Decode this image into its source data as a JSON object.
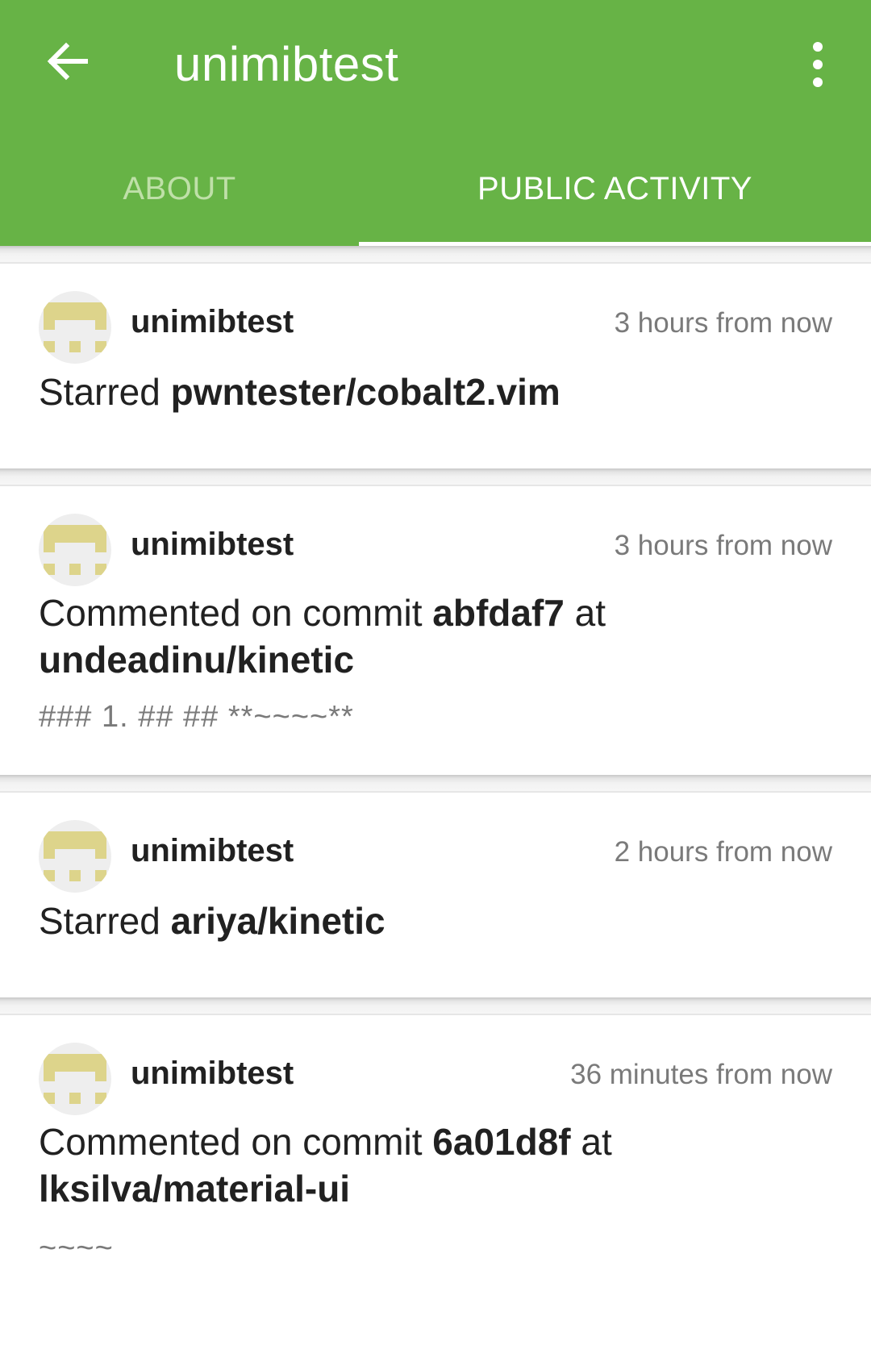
{
  "app_bar": {
    "title": "unimibtest",
    "back_icon": "arrow-left-icon",
    "menu_icon": "more-vertical-icon",
    "color": "#67b346"
  },
  "tabs": [
    {
      "label": "ABOUT",
      "selected": false
    },
    {
      "label": "PUBLIC ACTIVITY",
      "selected": true
    }
  ],
  "feed": [
    {
      "user": "unimibtest",
      "time": "3 hours from now",
      "action": "Starred ",
      "target": "pwntester/cobalt2.vim"
    },
    {
      "user": "unimibtest",
      "time": "3 hours from now",
      "action": "Commented on commit ",
      "commit": "abfdaf7",
      "connector": " at ",
      "repo": "undeadinu/kinetic",
      "snippet": "### 1. ## ## **~~~~**"
    },
    {
      "user": "unimibtest",
      "time": "2 hours from now",
      "action": "Starred ",
      "target": "ariya/kinetic"
    },
    {
      "user": "unimibtest",
      "time": "36 minutes from now",
      "action": "Commented on commit ",
      "commit": "6a01d8f",
      "connector": " at ",
      "repo": "lksilva/material-ui",
      "snippet": "~~~~"
    }
  ]
}
